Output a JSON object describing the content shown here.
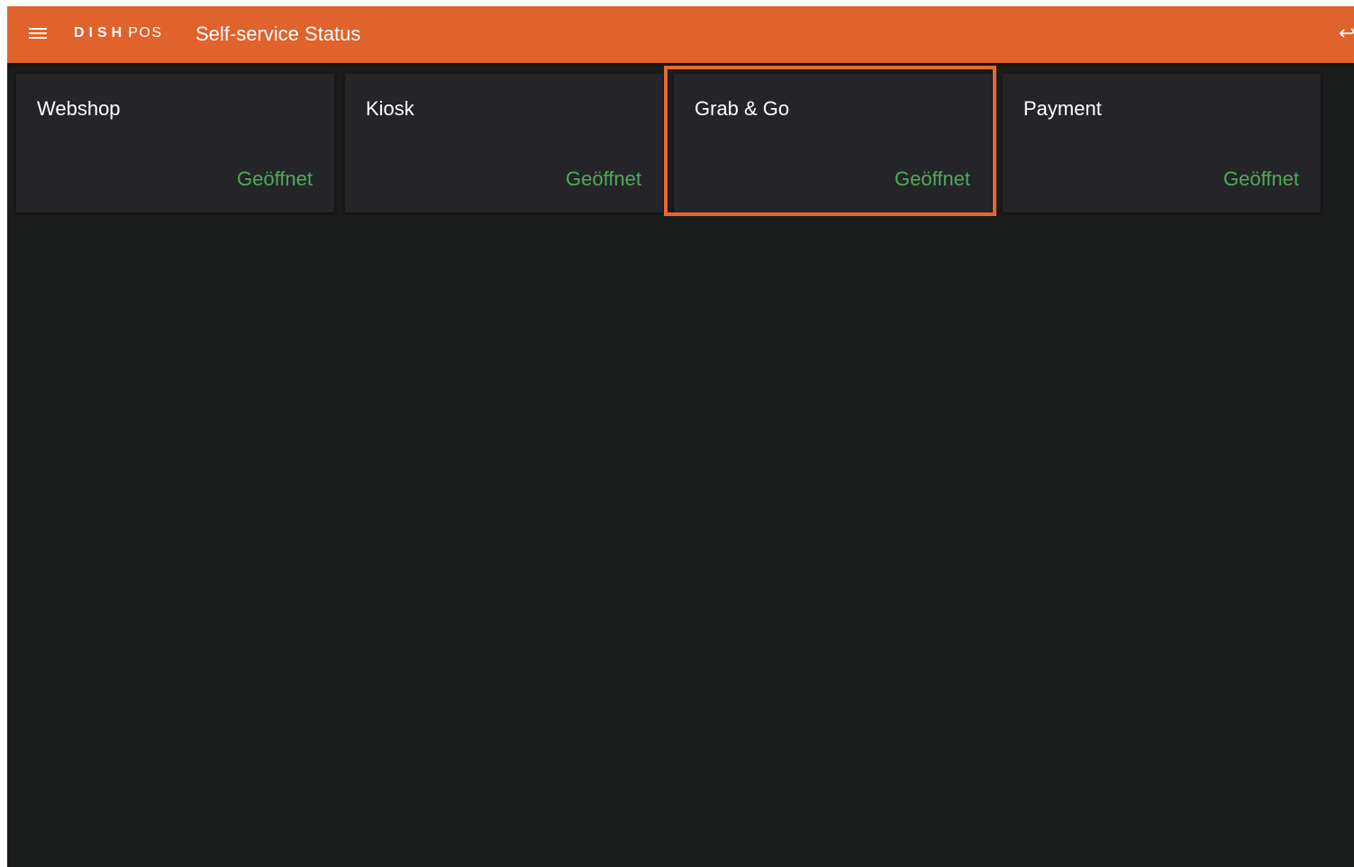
{
  "app": {
    "logo_primary": "DISH",
    "logo_secondary": "POS",
    "title": "Self-service Status"
  },
  "icons": {
    "menu": "hamburger-menu-icon",
    "exit": "logout-arrow-icon"
  },
  "colors": {
    "topbar": "#e0622c",
    "background": "#1b1c1c",
    "card": "#252529",
    "status_open": "#4faa5a",
    "highlight": "#e8662f"
  },
  "cards": [
    {
      "name": "Webshop",
      "status": "Geöffnet"
    },
    {
      "name": "Kiosk",
      "status": "Geöffnet"
    },
    {
      "name": "Grab & Go",
      "status": "Geöffnet",
      "highlighted": true
    },
    {
      "name": "Payment",
      "status": "Geöffnet"
    }
  ]
}
